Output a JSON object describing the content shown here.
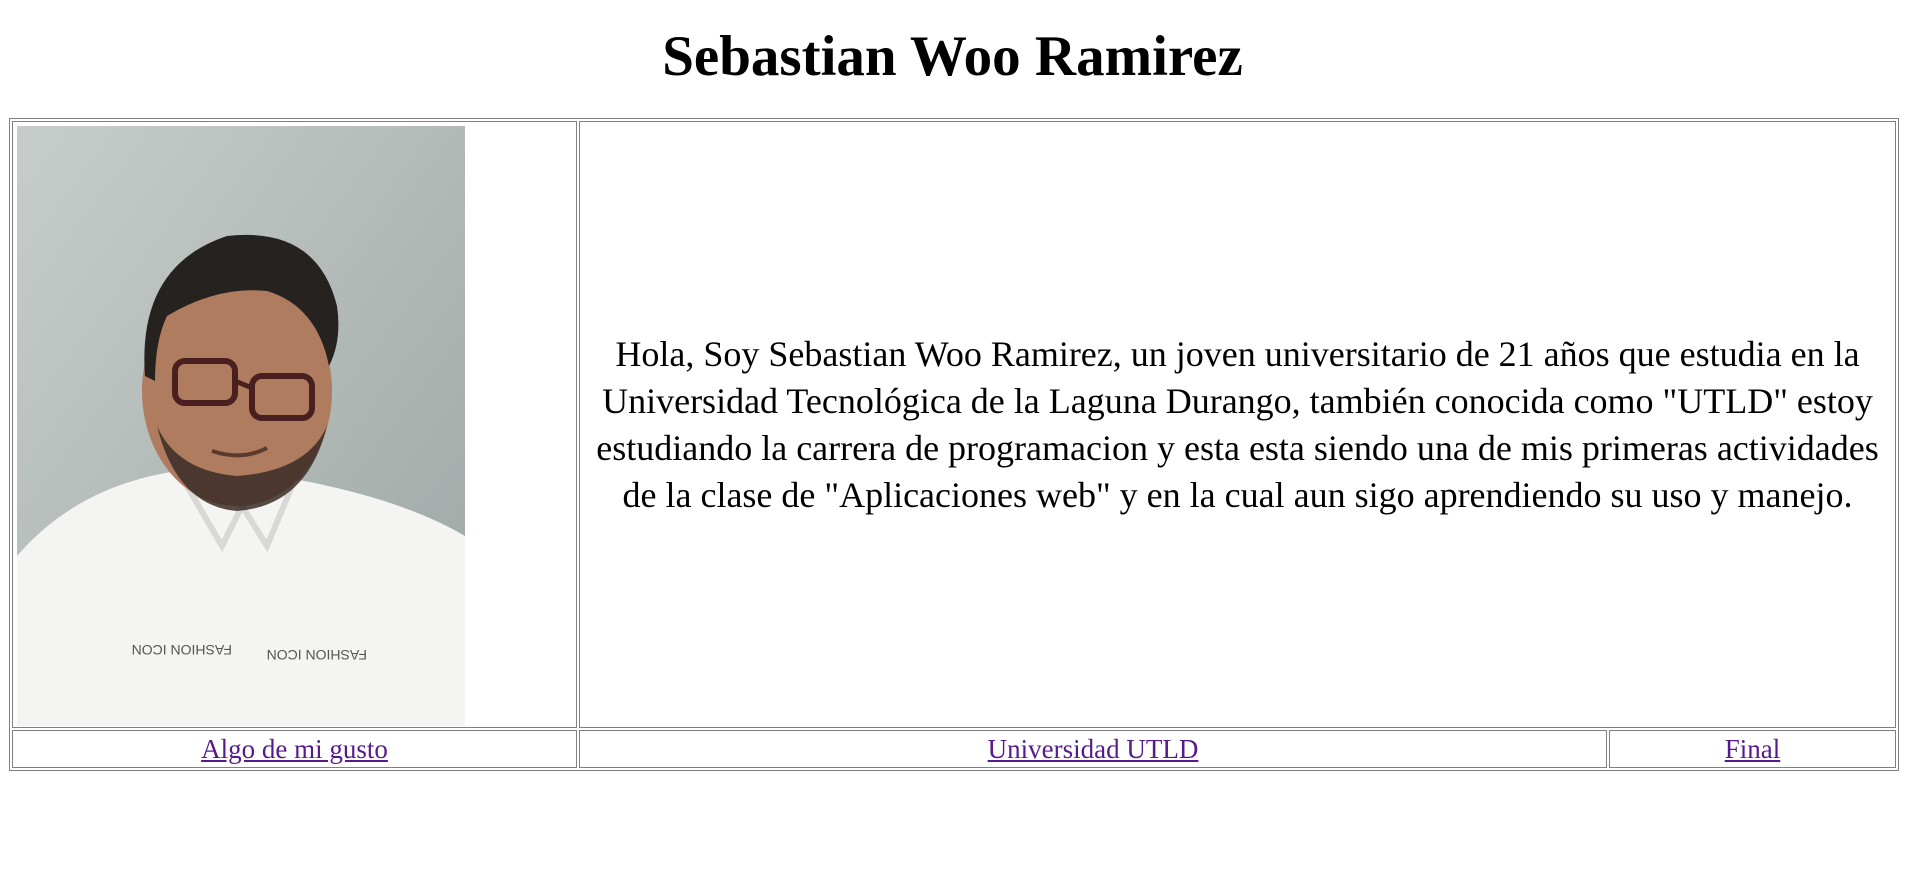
{
  "header": {
    "title": "Sebastian Woo Ramirez"
  },
  "profile": {
    "photo_icon": "person-portrait-photo",
    "bio": "Hola, Soy Sebastian Woo Ramirez, un joven universitario de 21 años que estudia en la Universidad Tecnológica de la Laguna Durango, también conocida como \"UTLD\" estoy estudiando la carrera de programacion y esta esta siendo una de mis primeras actividades de la clase de \"Aplicaciones web\" y en la cual aun sigo aprendiendo su uso y manejo."
  },
  "links": {
    "gusto": "Algo de mi gusto",
    "universidad": "Universidad UTLD",
    "final": "Final"
  },
  "colors": {
    "visited_link": "#551a8b",
    "table_border": "#808080"
  }
}
